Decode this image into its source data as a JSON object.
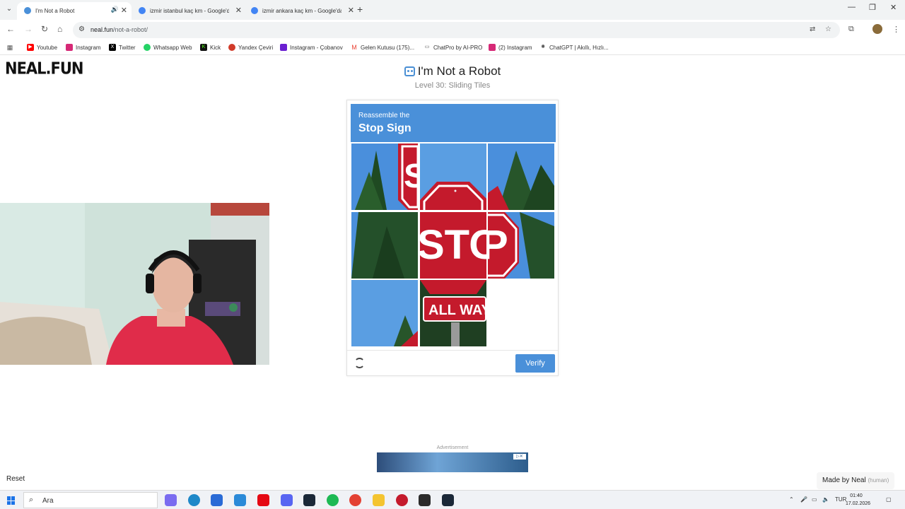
{
  "browser": {
    "tabs": [
      {
        "title": "I'm Not a Robot",
        "active": true,
        "favicon_color": "#4a90d9"
      },
      {
        "title": "izmir istanbul kaç km - Google'da Ara",
        "active": false,
        "favicon_color": "#4285f4"
      },
      {
        "title": "izmir ankara kaç km - Google'da Ara",
        "active": false,
        "favicon_color": "#4285f4"
      }
    ],
    "address": {
      "host": "neal.fun",
      "path": "/not-a-robot/"
    },
    "bookmarks": [
      {
        "label": "Youtube",
        "icon": "youtube-icon",
        "color": "#ff0000"
      },
      {
        "label": "Instagram",
        "icon": "instagram-icon",
        "color": "#d62976"
      },
      {
        "label": "Twitter",
        "icon": "x-icon",
        "color": "#000000"
      },
      {
        "label": "Whatsapp Web",
        "icon": "whatsapp-icon",
        "color": "#25d366"
      },
      {
        "label": "Kick",
        "icon": "kick-icon",
        "color": "#111111"
      },
      {
        "label": "Yandex Çeviri",
        "icon": "yandex-icon",
        "color": "#d13b2a"
      },
      {
        "label": "Instagram - Çobanov",
        "icon": "bookmark-icon",
        "color": "#6a1fd1"
      },
      {
        "label": "Gelen Kutusu (175)...",
        "icon": "gmail-icon",
        "color": "#ea4335"
      },
      {
        "label": "ChatPro by AI-PRO",
        "icon": "chat-icon",
        "color": "#555555"
      },
      {
        "label": "(2) Instagram",
        "icon": "instagram-icon",
        "color": "#d62976"
      },
      {
        "label": "ChatGPT | Akıllı, Hızlı...",
        "icon": "chatgpt-icon",
        "color": "#444444"
      }
    ]
  },
  "page": {
    "logo": "NEAL.FUN",
    "title": "I'm Not a Robot",
    "level": "Level 30: Sliding Tiles",
    "captcha": {
      "instruction": "Reassemble the",
      "target": "Stop Sign",
      "verify_label": "Verify",
      "stop_text": "STOP",
      "allway_text": "ALL WAY",
      "accent_color": "#4a90d9"
    },
    "ad_label": "Advertisement",
    "reset_label": "Reset",
    "made_by": "Made by Neal",
    "made_by_note": "(human)"
  },
  "taskbar": {
    "search_placeholder": "Ara",
    "language": "TUR",
    "time": "01:40",
    "date": "17.02.2026"
  }
}
